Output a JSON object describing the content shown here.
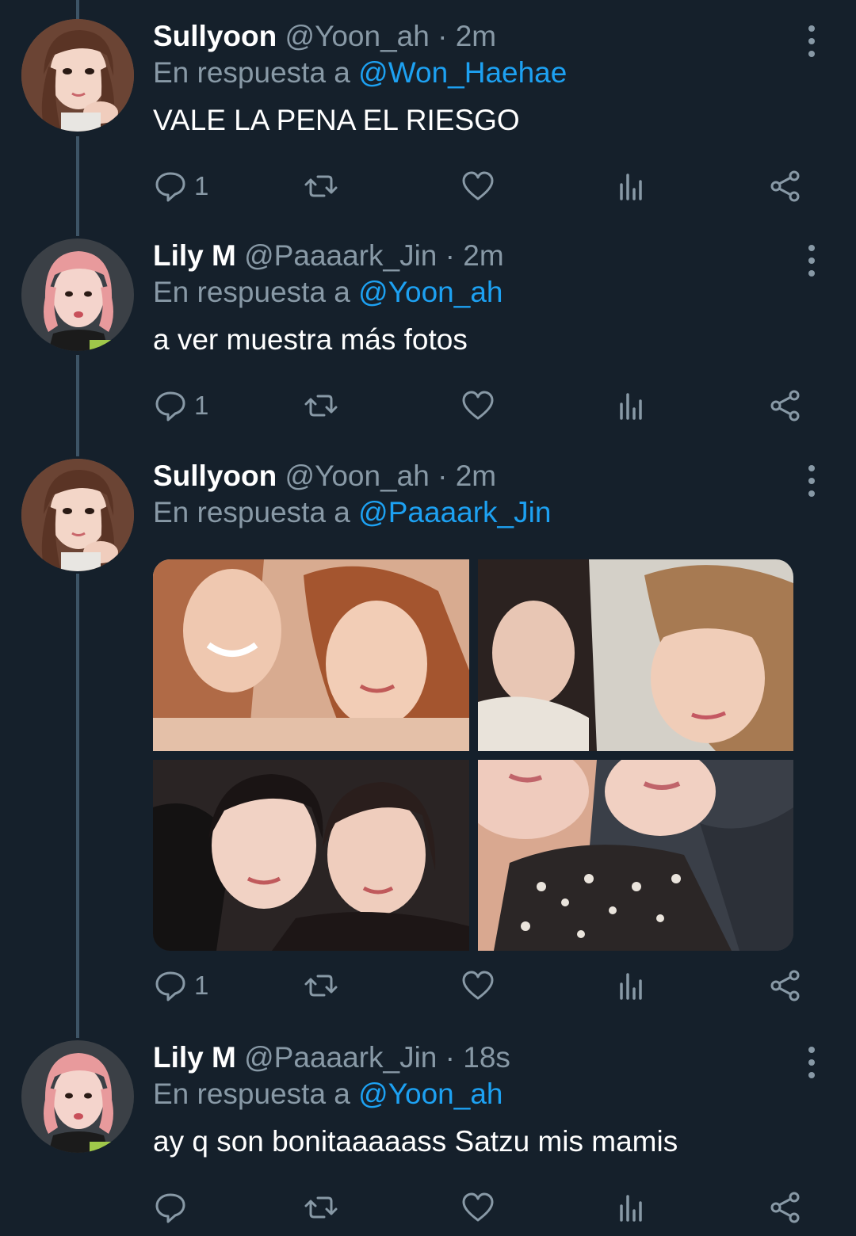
{
  "tweets": [
    {
      "name": "Sullyoon",
      "handle": "@Yoon_ah",
      "dot": " · ",
      "time": "2m",
      "reply_prefix": "En respuesta a ",
      "reply_to": "@Won_Haehae",
      "text": "VALE LA PENA EL RIESGO",
      "reply_count": "1"
    },
    {
      "name": "Lily M",
      "handle": "@Paaaark_Jin",
      "dot": " · ",
      "time": "2m",
      "reply_prefix": "En respuesta a ",
      "reply_to": "@Yoon_ah",
      "text": "a ver muestra más fotos",
      "reply_count": "1"
    },
    {
      "name": "Sullyoon",
      "handle": "@Yoon_ah",
      "dot": " · ",
      "time": "2m",
      "reply_prefix": "En respuesta a ",
      "reply_to": "@Paaaark_Jin",
      "media": [
        "photo-1",
        "photo-2",
        "photo-3",
        "photo-4"
      ],
      "reply_count": "1"
    },
    {
      "name": "Lily M",
      "handle": "@Paaaark_Jin",
      "dot": " · ",
      "time": "18s",
      "reply_prefix": "En respuesta a ",
      "reply_to": "@Yoon_ah",
      "text": "ay q son bonitaaaaass Satzu mis mamis",
      "reply_count": ""
    }
  ],
  "icons": {
    "reply": "reply-icon",
    "retweet": "retweet-icon",
    "like": "heart-icon",
    "analytics": "analytics-icon",
    "share": "share-icon",
    "more": "more-icon"
  },
  "colors": {
    "background": "#15202b",
    "secondary_text": "#8899a6",
    "mention": "#1da1f2",
    "thread_line": "#3d5466"
  }
}
